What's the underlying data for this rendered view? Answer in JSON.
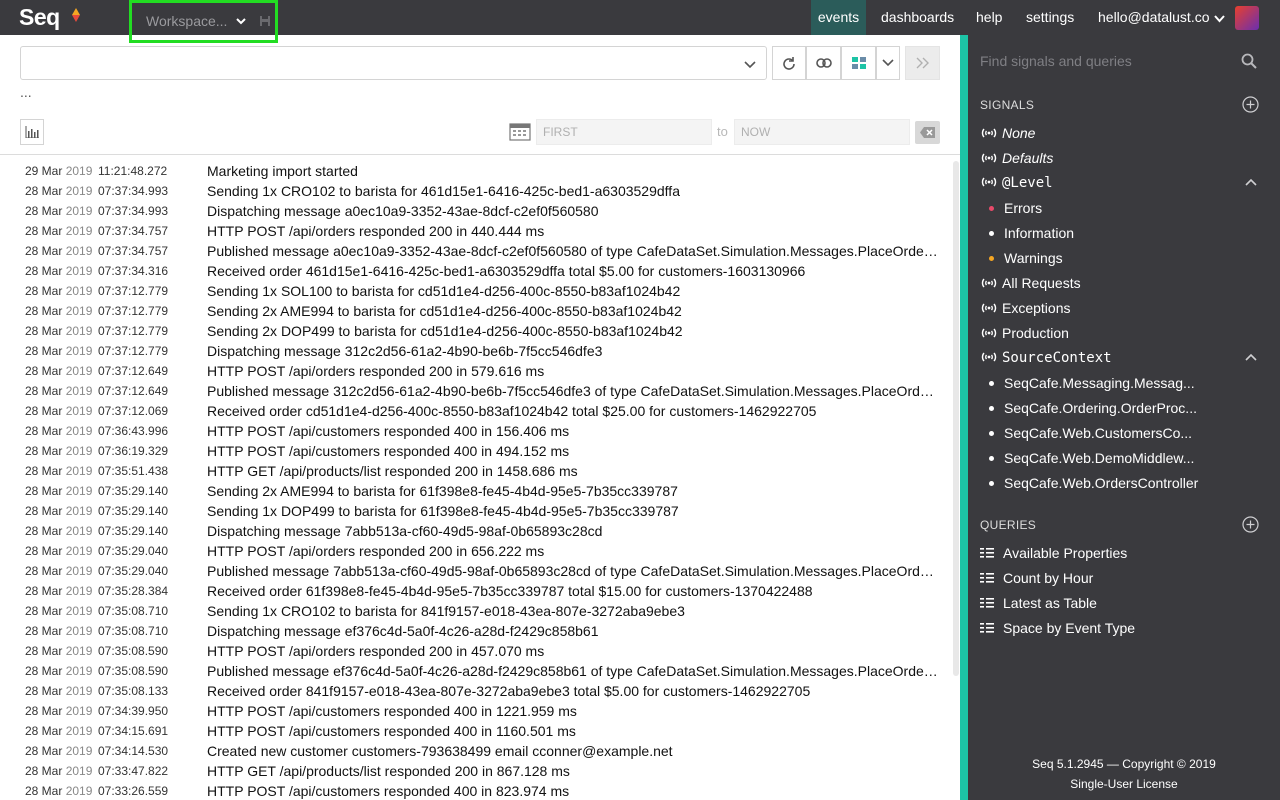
{
  "app": {
    "logo": "Seq"
  },
  "workspace": {
    "label": "Workspace..."
  },
  "nav": [
    {
      "label": "events",
      "active": true
    },
    {
      "label": "dashboards"
    },
    {
      "label": "help"
    },
    {
      "label": "settings"
    },
    {
      "label": "hello@datalust.co"
    }
  ],
  "toolbar": {
    "more": "...",
    "date_from_placeholder": "FIRST",
    "date_to_placeholder": "NOW",
    "to_label": "to"
  },
  "events": [
    {
      "day": "29 Mar",
      "year": "2019",
      "time": "11:21:48.272",
      "message": "Marketing import started"
    },
    {
      "day": "28 Mar",
      "year": "2019",
      "time": "07:37:34.993",
      "message": "Sending 1x CRO102 to barista for 461d15e1-6416-425c-bed1-a6303529dffa"
    },
    {
      "day": "28 Mar",
      "year": "2019",
      "time": "07:37:34.993",
      "message": "Dispatching message a0ec10a9-3352-43ae-8dcf-c2ef0f560580"
    },
    {
      "day": "28 Mar",
      "year": "2019",
      "time": "07:37:34.757",
      "message": "HTTP POST /api/orders responded 200 in 440.444 ms"
    },
    {
      "day": "28 Mar",
      "year": "2019",
      "time": "07:37:34.757",
      "message": "Published message a0ec10a9-3352-43ae-8dcf-c2ef0f560580 of type CafeDataSet.Simulation.Messages.PlaceOrder..."
    },
    {
      "day": "28 Mar",
      "year": "2019",
      "time": "07:37:34.316",
      "message": "Received order 461d15e1-6416-425c-bed1-a6303529dffa total $5.00 for customers-1603130966"
    },
    {
      "day": "28 Mar",
      "year": "2019",
      "time": "07:37:12.779",
      "message": "Sending 1x SOL100 to barista for cd51d1e4-d256-400c-8550-b83af1024b42"
    },
    {
      "day": "28 Mar",
      "year": "2019",
      "time": "07:37:12.779",
      "message": "Sending 2x AME994 to barista for cd51d1e4-d256-400c-8550-b83af1024b42"
    },
    {
      "day": "28 Mar",
      "year": "2019",
      "time": "07:37:12.779",
      "message": "Sending 2x DOP499 to barista for cd51d1e4-d256-400c-8550-b83af1024b42"
    },
    {
      "day": "28 Mar",
      "year": "2019",
      "time": "07:37:12.779",
      "message": "Dispatching message 312c2d56-61a2-4b90-be6b-7f5cc546dfe3"
    },
    {
      "day": "28 Mar",
      "year": "2019",
      "time": "07:37:12.649",
      "message": "HTTP POST /api/orders responded 200 in 579.616 ms"
    },
    {
      "day": "28 Mar",
      "year": "2019",
      "time": "07:37:12.649",
      "message": "Published message 312c2d56-61a2-4b90-be6b-7f5cc546dfe3 of type CafeDataSet.Simulation.Messages.PlaceOrde..."
    },
    {
      "day": "28 Mar",
      "year": "2019",
      "time": "07:37:12.069",
      "message": "Received order cd51d1e4-d256-400c-8550-b83af1024b42 total $25.00 for customers-1462922705"
    },
    {
      "day": "28 Mar",
      "year": "2019",
      "time": "07:36:43.996",
      "message": "HTTP POST /api/customers responded 400 in 156.406 ms"
    },
    {
      "day": "28 Mar",
      "year": "2019",
      "time": "07:36:19.329",
      "message": "HTTP POST /api/customers responded 400 in 494.152 ms"
    },
    {
      "day": "28 Mar",
      "year": "2019",
      "time": "07:35:51.438",
      "message": "HTTP GET /api/products/list responded 200 in 1458.686 ms"
    },
    {
      "day": "28 Mar",
      "year": "2019",
      "time": "07:35:29.140",
      "message": "Sending 2x AME994 to barista for 61f398e8-fe45-4b4d-95e5-7b35cc339787"
    },
    {
      "day": "28 Mar",
      "year": "2019",
      "time": "07:35:29.140",
      "message": "Sending 1x DOP499 to barista for 61f398e8-fe45-4b4d-95e5-7b35cc339787"
    },
    {
      "day": "28 Mar",
      "year": "2019",
      "time": "07:35:29.140",
      "message": "Dispatching message 7abb513a-cf60-49d5-98af-0b65893c28cd"
    },
    {
      "day": "28 Mar",
      "year": "2019",
      "time": "07:35:29.040",
      "message": "HTTP POST /api/orders responded 200 in 656.222 ms"
    },
    {
      "day": "28 Mar",
      "year": "2019",
      "time": "07:35:29.040",
      "message": "Published message 7abb513a-cf60-49d5-98af-0b65893c28cd of type CafeDataSet.Simulation.Messages.PlaceOrde..."
    },
    {
      "day": "28 Mar",
      "year": "2019",
      "time": "07:35:28.384",
      "message": "Received order 61f398e8-fe45-4b4d-95e5-7b35cc339787 total $15.00 for customers-1370422488"
    },
    {
      "day": "28 Mar",
      "year": "2019",
      "time": "07:35:08.710",
      "message": "Sending 1x CRO102 to barista for 841f9157-e018-43ea-807e-3272aba9ebe3"
    },
    {
      "day": "28 Mar",
      "year": "2019",
      "time": "07:35:08.710",
      "message": "Dispatching message ef376c4d-5a0f-4c26-a28d-f2429c858b61"
    },
    {
      "day": "28 Mar",
      "year": "2019",
      "time": "07:35:08.590",
      "message": "HTTP POST /api/orders responded 200 in 457.070 ms"
    },
    {
      "day": "28 Mar",
      "year": "2019",
      "time": "07:35:08.590",
      "message": "Published message ef376c4d-5a0f-4c26-a28d-f2429c858b61 of type CafeDataSet.Simulation.Messages.PlaceOrder..."
    },
    {
      "day": "28 Mar",
      "year": "2019",
      "time": "07:35:08.133",
      "message": "Received order 841f9157-e018-43ea-807e-3272aba9ebe3 total $5.00 for customers-1462922705"
    },
    {
      "day": "28 Mar",
      "year": "2019",
      "time": "07:34:39.950",
      "message": "HTTP POST /api/customers responded 400 in 1221.959 ms"
    },
    {
      "day": "28 Mar",
      "year": "2019",
      "time": "07:34:15.691",
      "message": "HTTP POST /api/customers responded 400 in 1160.501 ms"
    },
    {
      "day": "28 Mar",
      "year": "2019",
      "time": "07:34:14.530",
      "message": "Created new customer customers-793638499 email cconner@example.net"
    },
    {
      "day": "28 Mar",
      "year": "2019",
      "time": "07:33:47.822",
      "message": "HTTP GET /api/products/list responded 200 in 867.128 ms"
    },
    {
      "day": "28 Mar",
      "year": "2019",
      "time": "07:33:26.559",
      "message": "HTTP POST /api/customers responded 400 in 823.974 ms"
    }
  ],
  "sidebar": {
    "search_placeholder": "Find signals and queries",
    "signals_heading": "SIGNALS",
    "queries_heading": "QUERIES",
    "signals": {
      "none": "None",
      "defaults": "Defaults",
      "level": "@Level",
      "level_items": [
        {
          "label": "Errors",
          "color": "#e84a6a"
        },
        {
          "label": "Information",
          "color": "#ffffff"
        },
        {
          "label": "Warnings",
          "color": "#f5a623"
        }
      ],
      "all_requests": "All Requests",
      "exceptions": "Exceptions",
      "production": "Production",
      "source_context": "SourceContext",
      "source_items": [
        "SeqCafe.Messaging.Messag...",
        "SeqCafe.Ordering.OrderProc...",
        "SeqCafe.Web.CustomersCo...",
        "SeqCafe.Web.DemoMiddlew...",
        "SeqCafe.Web.OrdersController"
      ]
    },
    "queries": [
      "Available Properties",
      "Count by Hour",
      "Latest as Table",
      "Space by Event Type"
    ],
    "footer_line1": "Seq 5.1.2945 — Copyright © 2019",
    "footer_line2": "Single-User License"
  },
  "colors": {
    "accent": "#1dc4a6",
    "topbar": "#3a3a3e",
    "active_tab": "#2b5c5a"
  }
}
